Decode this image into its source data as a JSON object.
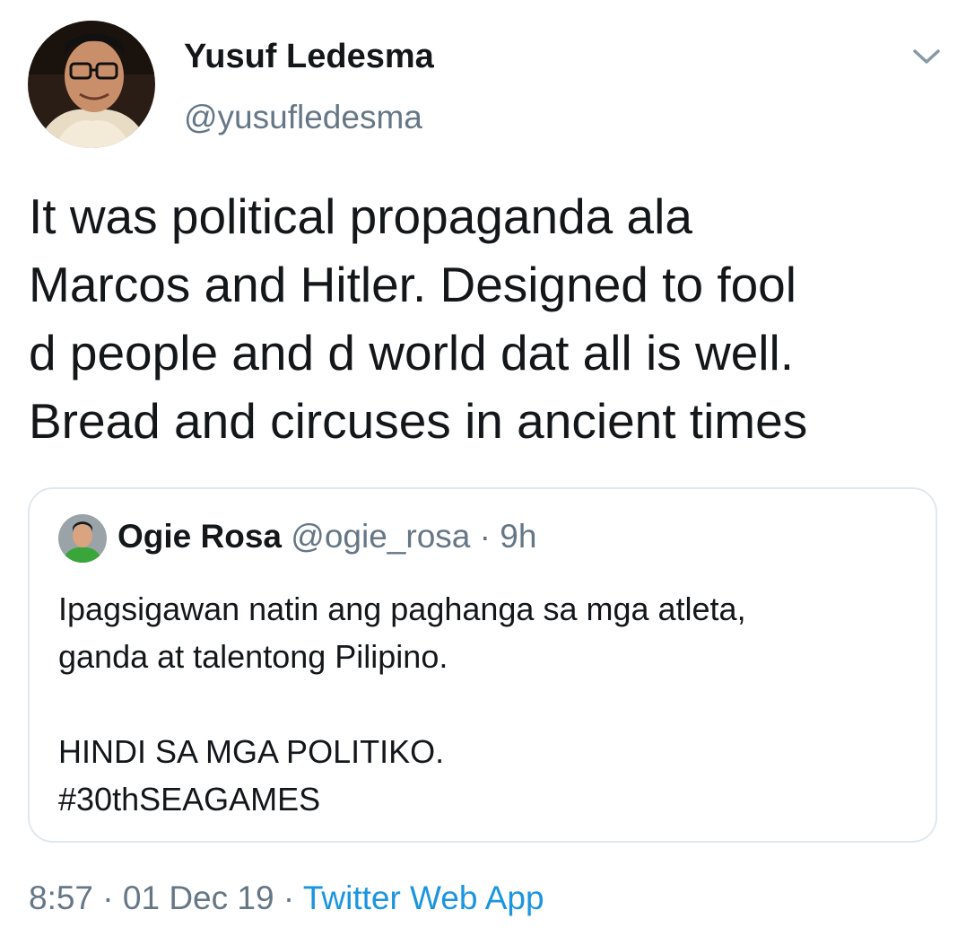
{
  "author": {
    "display_name": "Yusuf Ledesma",
    "handle": "@yusufledesma",
    "avatar_icon": "profile-photo"
  },
  "tweet": {
    "lines": [
      "It was political propaganda ala",
      "Marcos and Hitler. Designed to fool",
      "d people and d world dat all is well.",
      "Bread and circuses in ancient times"
    ]
  },
  "quoted_tweet": {
    "display_name": "Ogie Rosa",
    "handle": "@ogie_rosa",
    "separator": "·",
    "time_ago": "9h",
    "lines": [
      "Ipagsigawan natin ang paghanga sa mga atleta,",
      "ganda at talentong Pilipino.",
      "",
      "HINDI SA MGA POLITIKO.",
      "#30thSEAGAMES"
    ]
  },
  "footer": {
    "time": "8:57",
    "separator": "·",
    "date": "01 Dec 19",
    "source": "Twitter Web App"
  },
  "colors": {
    "text": "#14171a",
    "secondary": "#657786",
    "link": "#1b95e0",
    "border": "#e1e8ed"
  }
}
